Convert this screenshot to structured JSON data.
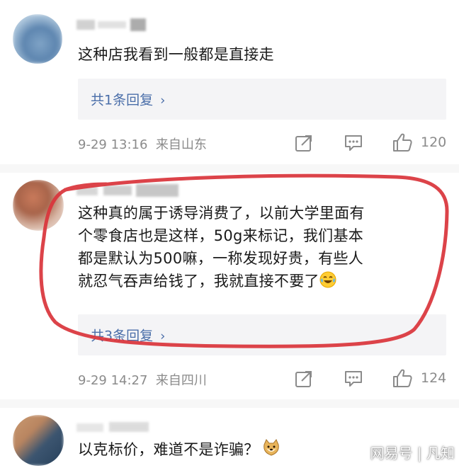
{
  "comments": [
    {
      "text": "这种店我看到一般都是直接走",
      "replies_label": "共1条回复",
      "time": "9-29 13:16",
      "location": "来自山东",
      "like_count": "120"
    },
    {
      "lines": [
        "这种真的属于诱导消费了，以前大学里面有",
        "个零食店也是这样，50g来标记，我们基本",
        "都是默认为500嘛，一称发现好贵，有些人",
        "就忍气吞声给钱了，我就直接不要了"
      ],
      "emoji": "crying-laughing-emoji",
      "replies_label": "共3条回复",
      "time": "9-29 14:27",
      "location": "来自四川",
      "like_count": "124"
    },
    {
      "text": "以克标价，难道不是诈骗？",
      "emoji": "doge-emoji"
    }
  ],
  "icons": {
    "repost": "repost-icon",
    "comment": "comment-icon",
    "like": "like-icon",
    "chevron": "chevron-right-icon"
  },
  "colors": {
    "reply_link": "#4a6ea9",
    "meta_text": "#8b8b8b",
    "annotation_red": "#d9353b"
  },
  "watermark": "网易号 | 凡知"
}
